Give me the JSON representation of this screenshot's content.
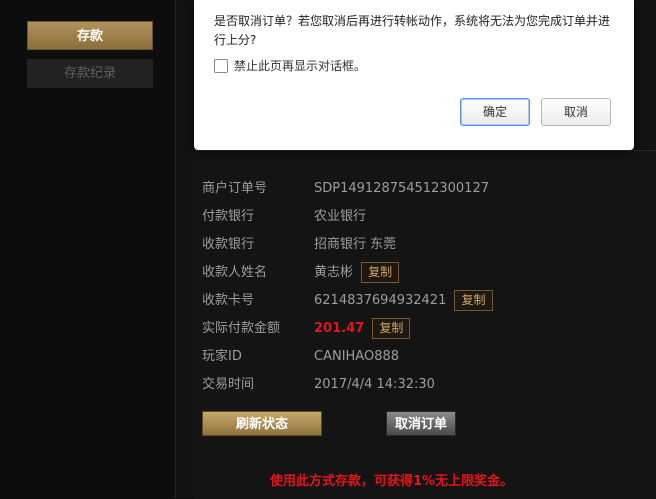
{
  "sidebar": {
    "deposit_label": "存款",
    "history_label": "存款纪录"
  },
  "dialog": {
    "message": "是否取消订单？若您取消后再进行转帐动作，系统将无法为您完成订单并进行上分?",
    "checkbox_label": "禁止此页再显示对话框。",
    "checkbox_checked": false,
    "ok_label": "确定",
    "cancel_label": "取消"
  },
  "order": {
    "rows": [
      {
        "label": "商户订单号",
        "value": "SDP149128754512300127"
      },
      {
        "label": "付款银行",
        "value": "农业银行"
      },
      {
        "label": "收款银行",
        "value": "招商银行 东莞"
      },
      {
        "label": "收款人姓名",
        "value": "黄志彬",
        "copy": "复制"
      },
      {
        "label": "收款卡号",
        "value": "6214837694932421",
        "copy": "复制"
      },
      {
        "label": "实际付款金额",
        "value": "201.47",
        "copy": "复制"
      },
      {
        "label": "玩家ID",
        "value": "CANIHAO888"
      },
      {
        "label": "交易时间",
        "value": "2017/4/4 14:32:30"
      }
    ],
    "refresh_label": "刷新状态",
    "cancel_order_label": "取消订单",
    "promo_text": "使用此方式存款，可获得1%无上限奖金。"
  },
  "colors": {
    "gold": "#b0925a",
    "red": "#e3141b",
    "background": "#0b0b0b"
  }
}
